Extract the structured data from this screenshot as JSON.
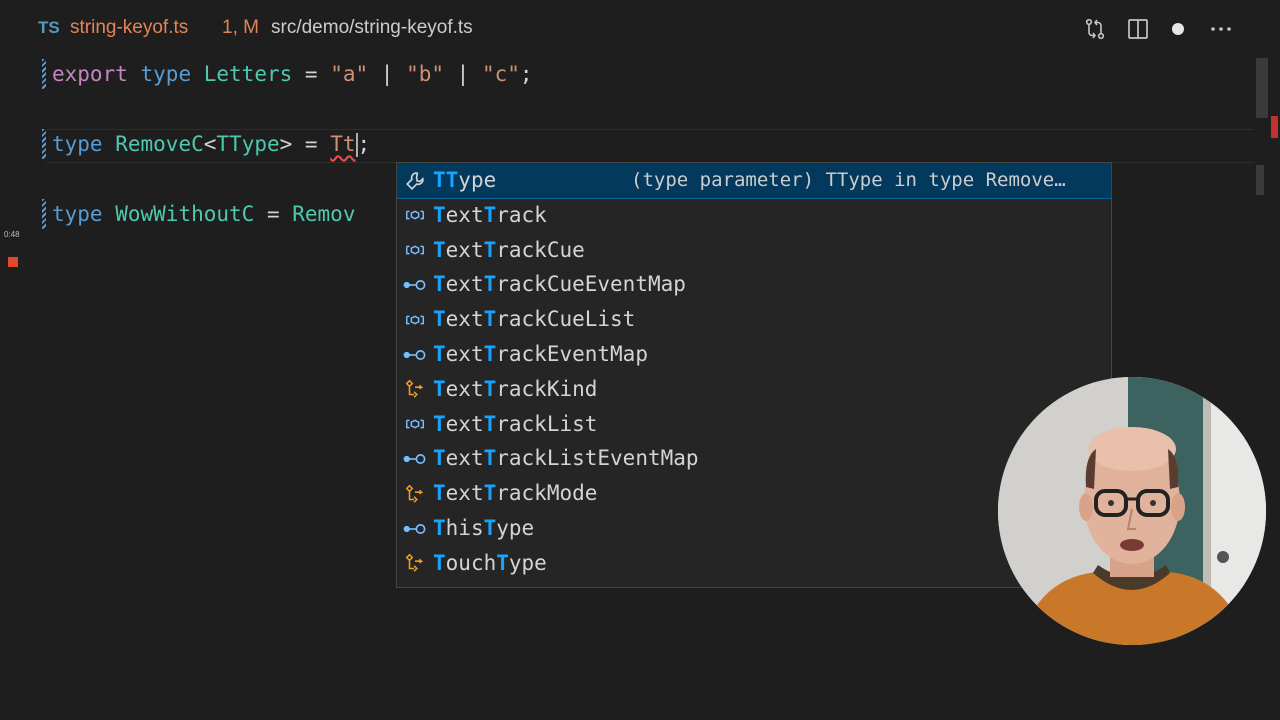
{
  "tab": {
    "lang_badge": "TS",
    "file_name": "string-keyof.ts",
    "status": "1, M",
    "path": "src/demo/string-keyof.ts"
  },
  "actions": [
    {
      "icon": "compare-changes-icon"
    },
    {
      "icon": "split-editor-icon"
    },
    {
      "icon": "unsaved-dot-icon"
    },
    {
      "icon": "more-actions-icon"
    }
  ],
  "recording": {
    "timer": "0:48"
  },
  "code": {
    "line1": {
      "kw": "export",
      "kw2": "type",
      "name": "Letters",
      "eq": " = ",
      "s1": "\"a\"",
      "p1": " | ",
      "s2": "\"b\"",
      "p2": " | ",
      "s3": "\"c\"",
      "end": ";"
    },
    "line2": {
      "kw": "type",
      "name": "RemoveC",
      "lt": "<",
      "param": "TType",
      "gt": ">",
      "eq": " = ",
      "typed": "Tt",
      "end": ";"
    },
    "line3": {
      "kw": "type",
      "name": "WowWithoutC",
      "eq": " = ",
      "rest": "Remov"
    }
  },
  "suggestions": [
    {
      "prefix": "TT",
      "rest": "ype",
      "kind": "wrench-icon",
      "detail": "(type parameter) TType in type Remove…",
      "selected": true
    },
    {
      "prefix": "T",
      "mid": "ext",
      "hl2": "T",
      "rest": "rack",
      "kind": "interface-icon"
    },
    {
      "prefix": "T",
      "mid": "ext",
      "hl2": "T",
      "rest": "rackCue",
      "kind": "interface-icon"
    },
    {
      "prefix": "T",
      "mid": "ext",
      "hl2": "T",
      "rest": "rackCueEventMap",
      "kind": "property-icon"
    },
    {
      "prefix": "T",
      "mid": "ext",
      "hl2": "T",
      "rest": "rackCueList",
      "kind": "interface-icon"
    },
    {
      "prefix": "T",
      "mid": "ext",
      "hl2": "T",
      "rest": "rackEventMap",
      "kind": "property-icon"
    },
    {
      "prefix": "T",
      "mid": "ext",
      "hl2": "T",
      "rest": "rackKind",
      "kind": "type-alias-icon"
    },
    {
      "prefix": "T",
      "mid": "ext",
      "hl2": "T",
      "rest": "rackList",
      "kind": "interface-icon"
    },
    {
      "prefix": "T",
      "mid": "ext",
      "hl2": "T",
      "rest": "rackListEventMap",
      "kind": "property-icon"
    },
    {
      "prefix": "T",
      "mid": "ext",
      "hl2": "T",
      "rest": "rackMode",
      "kind": "type-alias-icon"
    },
    {
      "prefix": "T",
      "mid": "his",
      "hl2": "T",
      "rest": "ype",
      "kind": "property-icon"
    },
    {
      "prefix": "T",
      "mid": "ouch",
      "hl2": "T",
      "rest": "ype",
      "kind": "type-alias-icon"
    }
  ],
  "colors": {
    "accent": "#18a3ff",
    "selection": "#04395e",
    "modified": "#e2845a",
    "record": "#e5482d"
  }
}
